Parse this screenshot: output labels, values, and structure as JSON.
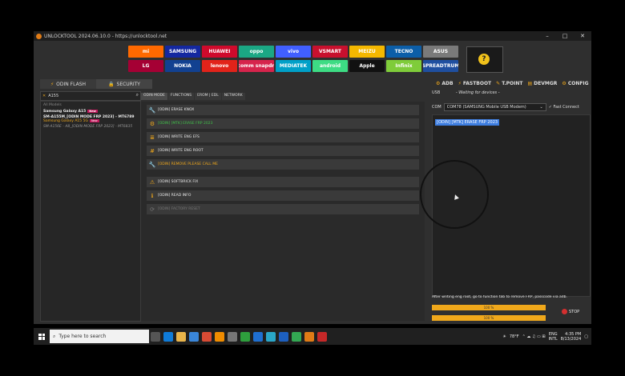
{
  "window": {
    "title": "UNLOCKTOOL 2024.06.10.0 - https://unlocktool.net",
    "min": "–",
    "max": "□",
    "close": "✕"
  },
  "brands": [
    {
      "label": "mi",
      "color": "#ff6900"
    },
    {
      "label": "SAMSUNG",
      "color": "#1428a0"
    },
    {
      "label": "HUAWEI",
      "color": "#cf0a2c"
    },
    {
      "label": "oppo",
      "color": "#1ba784"
    },
    {
      "label": "vivo",
      "color": "#415fff"
    },
    {
      "label": "VSMART",
      "color": "#c8102e"
    },
    {
      "label": "MEIZU",
      "color": "#f5b800"
    },
    {
      "label": "TECNO",
      "color": "#0c5ea8"
    },
    {
      "label": "ASUS",
      "color": "#7a7a7a"
    },
    {
      "label": "LG",
      "color": "#a50034"
    },
    {
      "label": "NOKIA",
      "color": "#124191"
    },
    {
      "label": "lenovo",
      "color": "#e2231a"
    },
    {
      "label": "Qualcomm snapdragon",
      "color": "#d6244c"
    },
    {
      "label": "MEDIATEK",
      "color": "#00a0c8"
    },
    {
      "label": "android",
      "color": "#3ddc84"
    },
    {
      "label": "Apple",
      "color": "#111111"
    },
    {
      "label": "Infinix",
      "color": "#7fcc3a"
    },
    {
      "label": "SPREADTRUM",
      "color": "#1f4fa0"
    }
  ],
  "tabs": {
    "odin_flash": "ODIN FLASH",
    "security": "SECURITY"
  },
  "toolbar": {
    "adb": "ADB",
    "fastboot": "FASTBOOT",
    "tpoint": "T.POINT",
    "devmgr": "DEVMGR",
    "config": "CONFIG"
  },
  "search": {
    "value": "A155"
  },
  "models": {
    "all": "All Models",
    "items": [
      {
        "name": "Samsung Galaxy A15",
        "tag": "New"
      },
      {
        "name": "SM-A155M_[ODIN MODE FRP 2023] - MT6789",
        "sub": "Samsung Galaxy A15 5G",
        "tag": "New"
      },
      {
        "name": "SM-A156E - A8_[ODIN MODE FRP 2023] - MT6835"
      }
    ]
  },
  "midtabs": [
    "ODIN MODE",
    "FUNCTIONS",
    "EROM | EDL",
    "NETWORK"
  ],
  "functions": [
    {
      "label": "[ODIN] ERASE KNOX",
      "style": "normal",
      "icon": "wrench-icon",
      "glyph": "🔧"
    },
    {
      "label": "[ODIN] [MTK] ERASE FRP 2023",
      "style": "green",
      "icon": "gear-icon",
      "glyph": "⚙"
    },
    {
      "label": "[ODIN] WRITE ENG EFS",
      "style": "normal",
      "icon": "database-icon",
      "glyph": "≣"
    },
    {
      "label": "[ODIN] WRITE ENG ROOT",
      "style": "normal",
      "icon": "hash-icon",
      "glyph": "#"
    },
    {
      "label": "[ODIN] REMOVE PLEASE CALL ME",
      "style": "orange",
      "icon": "wrench-icon",
      "glyph": "🔧"
    },
    {
      "label": "[ODIN] SOFTBRICK FIX",
      "style": "normal",
      "icon": "warning-icon",
      "glyph": "⚠"
    },
    {
      "label": "[ODIN] READ INFO",
      "style": "normal",
      "icon": "info-icon",
      "glyph": "ℹ"
    },
    {
      "label": "[ODIN] FACTORY RESET",
      "style": "disabled",
      "icon": "reset-icon",
      "glyph": "⟳"
    }
  ],
  "usb": {
    "label": "USB",
    "status": "- Waiting for devices -"
  },
  "com": {
    "label": "COM",
    "port": "COM78 (SAMSUNG Mobile USB Modem)",
    "fast_connect": "Fast Connect"
  },
  "log": {
    "highlight": "[ODIN] [MTK] ERASE FRP 2023"
  },
  "hint": "After writing eng root, go to function tab to remove FRP, passcode via adb.",
  "progress": [
    {
      "text": "100 %",
      "value": 1.0
    },
    {
      "text": "100 %",
      "value": 1.0
    }
  ],
  "stop": "STOP",
  "taskbar": {
    "search_placeholder": "Type here to search",
    "weather": "78°F",
    "lang1": "ENG",
    "lang2": "INTL",
    "time": "4:35 PM",
    "date": "8/13/2024"
  }
}
